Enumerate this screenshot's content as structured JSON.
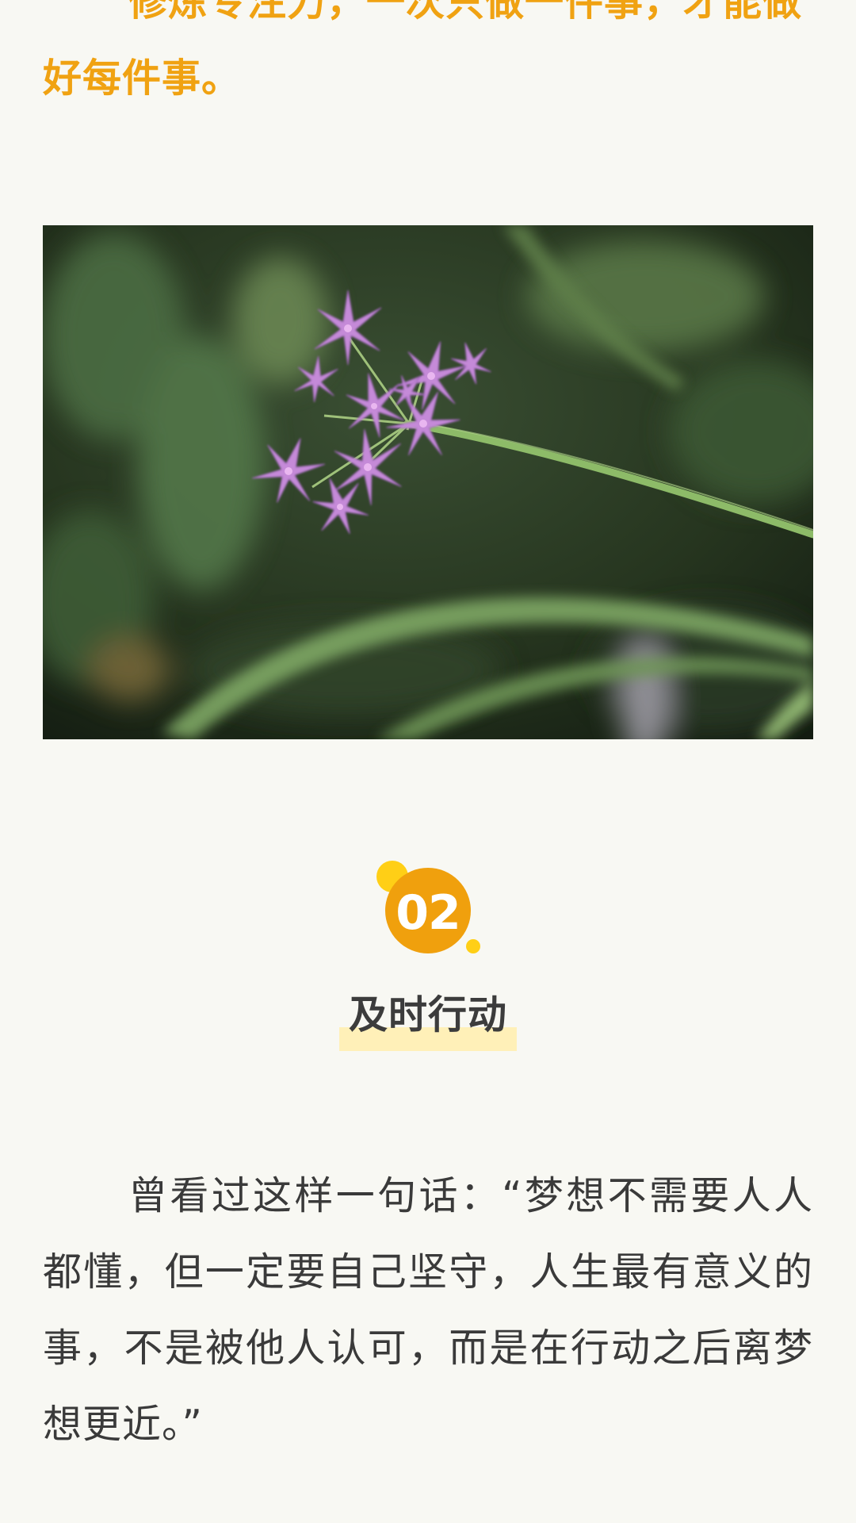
{
  "article": {
    "top_quote": "修炼专注力，一次只做一件事，才能做好每件事。",
    "photo": {
      "icon": "flower-photo",
      "colors": {
        "flower": "#c58ad8",
        "stem": "#86b964",
        "background_dark": "#1e2c1c",
        "background_mid": "#4f6e42"
      }
    },
    "section": {
      "number": "02",
      "title": "及时行动",
      "colors": {
        "badge": "#f0a00d",
        "badge_dots": "#ffcf16",
        "title_highlight": "#fff0b8"
      }
    },
    "paragraph": "曾看过这样一句话：“梦想不需要人人都懂，但一定要自己坚守，人生最有意义的事，不是被他人认可，而是在行动之后离梦想更近。”",
    "colors": {
      "page_bg": "#f8f8f3",
      "accent": "#f0a212",
      "text": "#3a3a3a"
    }
  }
}
